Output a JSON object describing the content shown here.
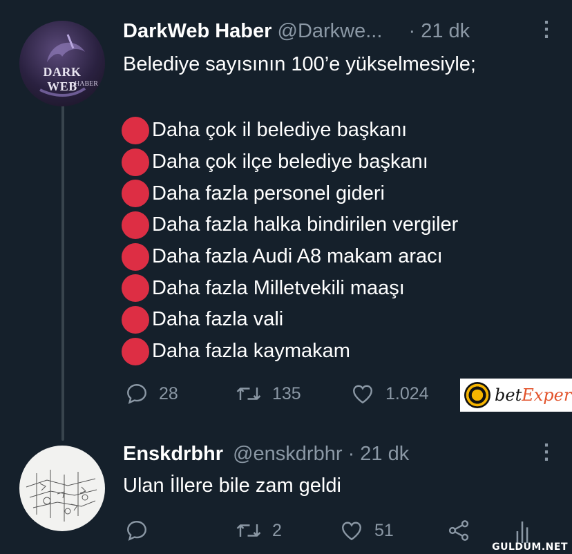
{
  "tweet": {
    "author_name": "DarkWeb Haber",
    "handle": "@Darkwe...",
    "time": "· 21 dk",
    "avatar_text": "DARK WEB",
    "avatar_subtext": "HABER",
    "intro": "Belediye sayısının 100’e yükselmesiyle;",
    "items": [
      "Daha çok il belediye başkanı",
      "Daha çok ilçe belediye başkanı",
      "Daha fazla personel gideri",
      "Daha fazla halka bindirilen vergiler",
      "Daha fazla Audi A8 makam aracı",
      "Daha fazla Milletvekili maaşı",
      "Daha fazla vali",
      "Daha fazla kaymakam"
    ],
    "actions": {
      "replies": "28",
      "retweets": "135",
      "likes": "1.024"
    }
  },
  "reply": {
    "author_name": "Enskdrbhr",
    "handle": "@enskdrbhr",
    "time": "· 21 dk",
    "text": "Ulan İllere bile zam geldi",
    "actions": {
      "retweets": "2",
      "likes": "51"
    }
  },
  "ad": {
    "brand_part1": "bet",
    "brand_part2": "Exper"
  },
  "watermark": "GULDUM.NET",
  "colors": {
    "background": "#15202b",
    "muted": "#8b98a5",
    "bullet": "#dd2e44",
    "thread_line": "#38444d"
  },
  "icons": [
    "reply-icon",
    "retweet-icon",
    "like-icon",
    "share-icon",
    "analytics-icon",
    "more-icon"
  ]
}
